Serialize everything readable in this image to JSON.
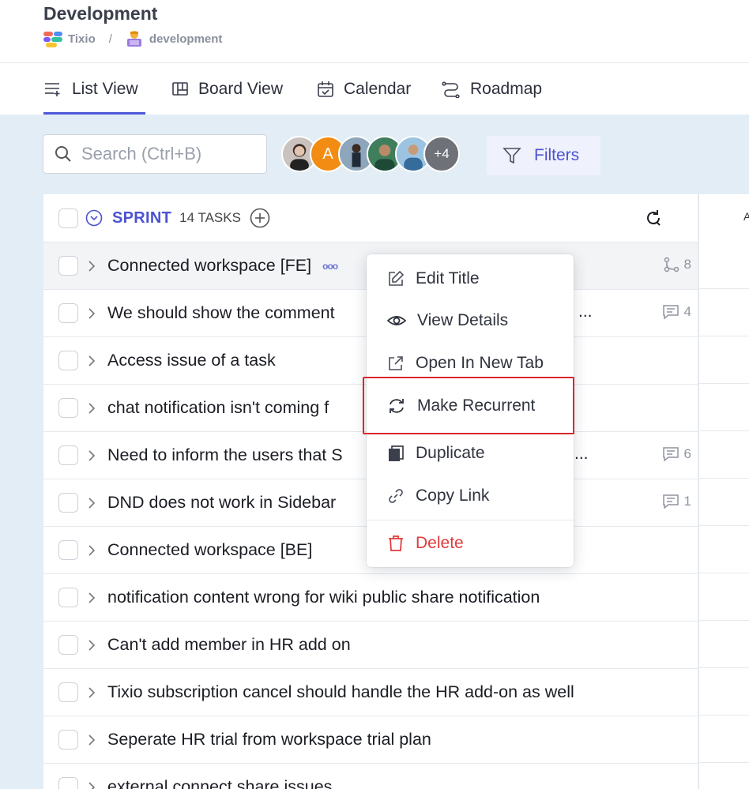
{
  "header": {
    "title": "Development",
    "breadcrumb": {
      "workspace": "Tixio",
      "separator": "/",
      "project": "development"
    }
  },
  "tabs": [
    {
      "label": "List View",
      "icon": "list-icon",
      "active": true
    },
    {
      "label": "Board View",
      "icon": "board-icon",
      "active": false
    },
    {
      "label": "Calendar",
      "icon": "calendar-icon",
      "active": false
    },
    {
      "label": "Roadmap",
      "icon": "roadmap-icon",
      "active": false
    }
  ],
  "toolbar": {
    "search_placeholder": "Search (Ctrl+B)",
    "avatars": [
      {
        "initial": "",
        "color": "#b9b2b0"
      },
      {
        "initial": "A",
        "color": "#f28c12"
      },
      {
        "initial": "",
        "color": "#6d7d8c"
      },
      {
        "initial": "",
        "color": "#2f6d4f"
      },
      {
        "initial": "",
        "color": "#6a9fc9"
      }
    ],
    "more_avatars": "+4",
    "filters_label": "Filters"
  },
  "sprint": {
    "title": "SPRINT",
    "count": "14 TASKS"
  },
  "right_column_header": "A",
  "tasks": [
    {
      "title": "Connected workspace [FE]",
      "meta": "8",
      "meta_icon": "subtask-icon"
    },
    {
      "title": "We should show the comment",
      "trailing": "...",
      "meta": "4",
      "meta_icon": "comment-icon"
    },
    {
      "title": "Access issue of a task"
    },
    {
      "title": "chat notification isn't coming f"
    },
    {
      "title": "Need to inform the users that S",
      "trailing": "...",
      "meta": "6",
      "meta_icon": "comment-icon"
    },
    {
      "title": "DND does not work in Sidebar",
      "meta": "1",
      "meta_icon": "comment-icon"
    },
    {
      "title": "Connected workspace [BE]"
    },
    {
      "title": "notification content wrong for wiki public share notification"
    },
    {
      "title": "Can't add member in HR add on"
    },
    {
      "title": "Tixio subscription cancel should handle the HR add-on as well"
    },
    {
      "title": "Seperate HR trial from workspace trial plan"
    },
    {
      "title": "external connect share issues"
    }
  ],
  "context_menu": {
    "items": [
      {
        "label": "Edit Title",
        "icon": "edit-icon"
      },
      {
        "label": "View Details",
        "icon": "eye-icon"
      },
      {
        "label": "Open In New Tab",
        "icon": "external-link-icon"
      },
      {
        "label": "Make Recurrent",
        "icon": "recurrent-icon"
      },
      {
        "label": "Duplicate",
        "icon": "duplicate-icon"
      },
      {
        "label": "Copy Link",
        "icon": "link-icon"
      },
      {
        "label": "Delete",
        "icon": "trash-icon"
      }
    ],
    "colors": {
      "danger": "#e23b3b",
      "highlight": "#d9262f"
    }
  },
  "colors": {
    "accent": "#4f57d8",
    "background": "#e3edf5"
  }
}
